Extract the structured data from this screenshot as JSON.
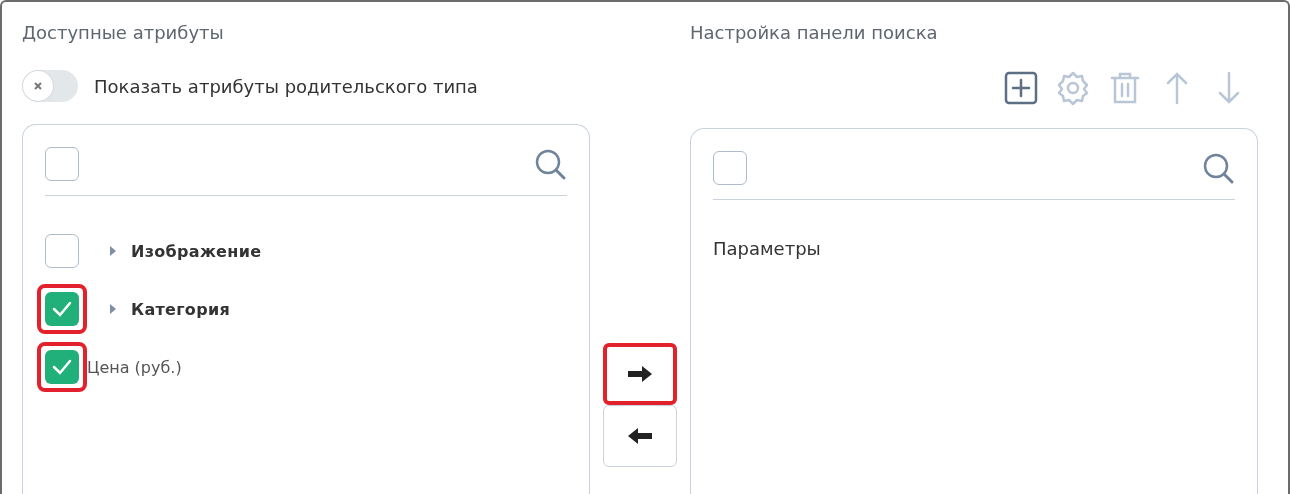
{
  "left": {
    "title": "Доступные атрибуты",
    "toggle": {
      "label": "Показать атрибуты родительского типа",
      "on": false
    },
    "panel": {
      "select_all": {
        "checked": false
      },
      "items": [
        {
          "kind": "group",
          "label": "Изображение",
          "checked": false,
          "highlighted": false,
          "expanded": false
        },
        {
          "kind": "group",
          "label": "Категория",
          "checked": true,
          "highlighted": true,
          "expanded": false
        },
        {
          "kind": "leaf",
          "label": "Цена (руб.)",
          "checked": true,
          "highlighted": true
        }
      ]
    }
  },
  "transfer": [
    {
      "kind": "right",
      "highlighted": true
    },
    {
      "kind": "left",
      "highlighted": false
    }
  ],
  "right": {
    "title": "Настройка панели поиска",
    "toolbar": [
      {
        "kind": "add",
        "disabled": false
      },
      {
        "kind": "settings",
        "disabled": true
      },
      {
        "kind": "delete",
        "disabled": true
      },
      {
        "kind": "up",
        "disabled": true
      },
      {
        "kind": "down",
        "disabled": true
      }
    ],
    "panel": {
      "select_all": {
        "checked": false
      },
      "heading": "Параметры"
    }
  }
}
